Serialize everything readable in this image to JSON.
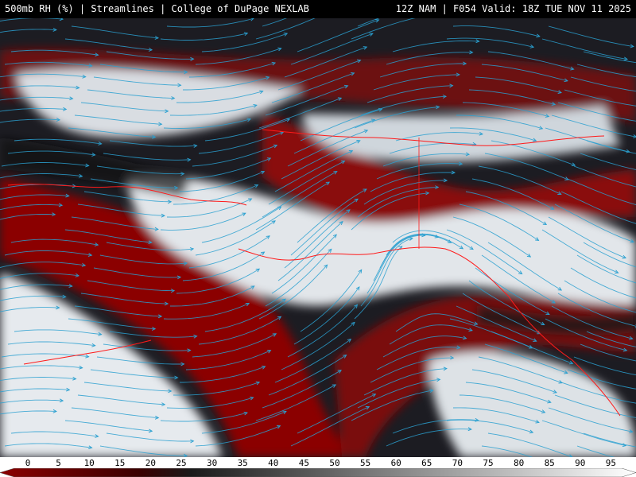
{
  "header": {
    "left_title": "500mb RH (%) | Streamlines | College of DuPage NEXLAB",
    "right_title": "12Z NAM | F054 Valid: 18Z TUE NOV 11 2025"
  },
  "legend": {
    "ticks": [
      "0",
      "5",
      "10",
      "15",
      "20",
      "25",
      "30",
      "35",
      "40",
      "45",
      "50",
      "55",
      "60",
      "65",
      "70",
      "75",
      "80",
      "85",
      "90",
      "95"
    ],
    "low_color": "#8b0000",
    "high_color": "#ffffff",
    "streamline_color": "#2aa0d0",
    "coastline_color": "#ff1a1a"
  },
  "map": {
    "field": "500mb relative humidity",
    "overlay": "streamlines",
    "borders": "coastlines and political boundaries"
  }
}
